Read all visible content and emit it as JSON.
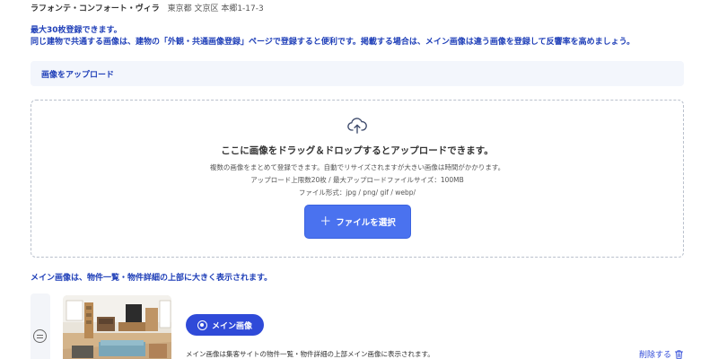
{
  "property": {
    "name": "ラフォンテ・コンフォート・ヴィラ",
    "address": "東京都 文京区 本郷1-17-3"
  },
  "notice": {
    "line1": "最大30枚登録できます。",
    "line2": "同じ建物で共通する画像は、建物の「外観・共通画像登録」ページで登録すると便利です。掲載する場合は、メイン画像は違う画像を登録して反響率を高めましょう。"
  },
  "upload": {
    "header": "画像をアップロード",
    "title": "ここに画像をドラッグ＆ドロップするとアップロードできます。",
    "line1": "複数の画像をまとめて登録できます。自動でリサイズされますが大きい画像は時間がかかります。",
    "line2": "アップロード上限数20枚 / 最大アップロードファイルサイズ：100MB",
    "line3": "ファイル形式：jpg / png/ gif / webp/",
    "button_label": "ファイルを選択",
    "button_icon": "plus-icon",
    "zone_icon": "cloud-upload-icon"
  },
  "main_image": {
    "note": "メイン画像は、物件一覧・物件詳細の上部に大きく表示されます。",
    "badge_label": "メイン画像",
    "description": "メイン画像は集客サイトの物件一覧・物件詳細の上部メイン画像に表示されます。",
    "delete_label": "削除する",
    "delete_icon": "trash-icon",
    "handle_icon": "drag-handle-icon"
  },
  "colors": {
    "accent": "#2f4ad8",
    "button": "#4a72ef",
    "link_text": "#1f3fb8",
    "panel_bg": "#f3f6fc"
  }
}
